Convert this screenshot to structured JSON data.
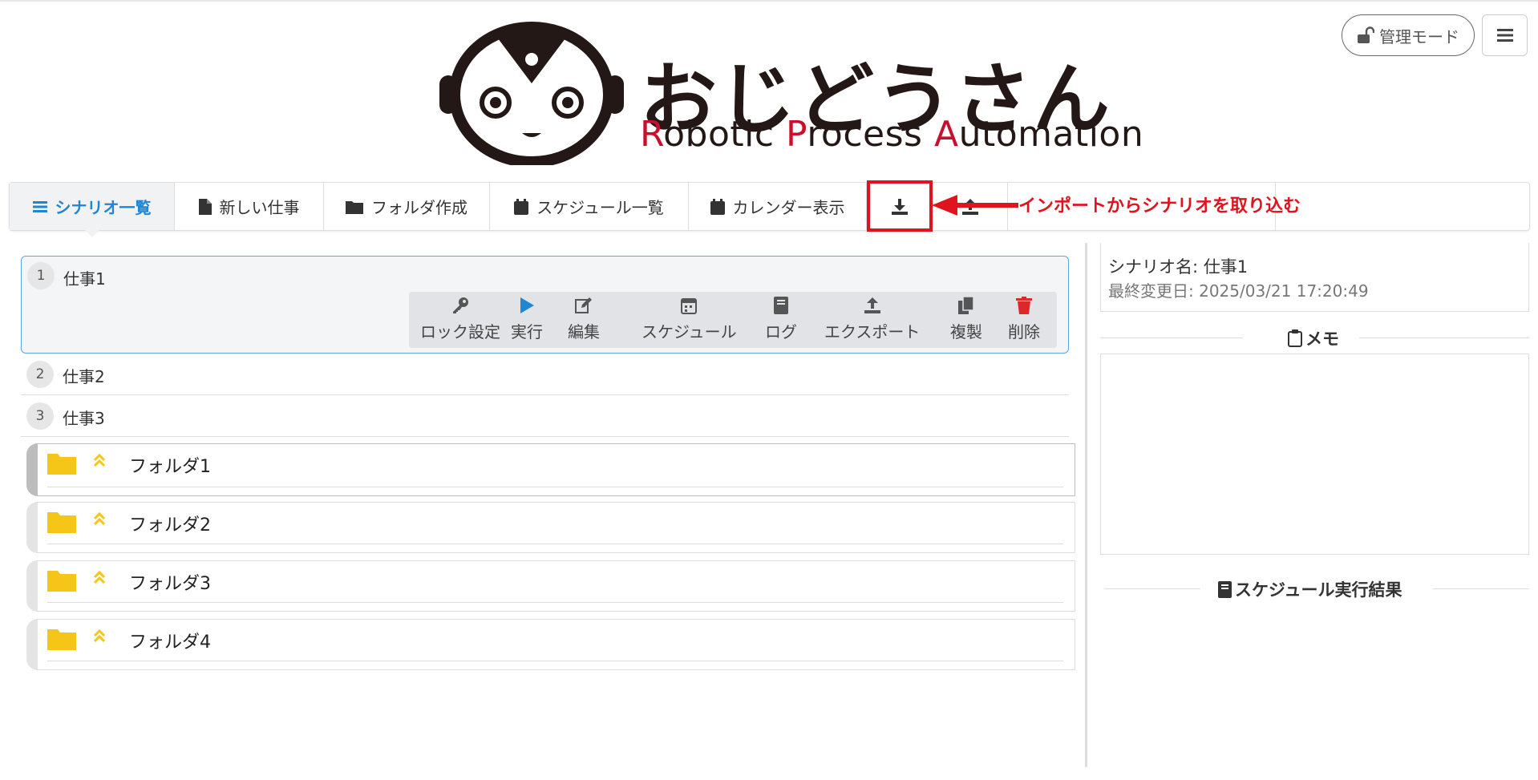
{
  "header": {
    "logo_title": "おじどうさん",
    "logo_sub_r1": "R",
    "logo_sub_1": "obotic ",
    "logo_sub_r2": "P",
    "logo_sub_2": "rocess ",
    "logo_sub_r3": "A",
    "logo_sub_3": "utomation",
    "admin_label": "管理モード"
  },
  "tabs": [
    {
      "label": "シナリオ一覧",
      "icon": "list-icon"
    },
    {
      "label": "新しい仕事",
      "icon": "file-icon"
    },
    {
      "label": "フォルダ作成",
      "icon": "folder-icon"
    },
    {
      "label": "スケジュール一覧",
      "icon": "calendar-icon"
    },
    {
      "label": "カレンダー表示",
      "icon": "calendar-icon"
    },
    {
      "label": "",
      "icon": "import-icon"
    },
    {
      "label": "",
      "icon": "export-icon"
    }
  ],
  "annotation": "インポートからシナリオを取り込む",
  "tasks": [
    {
      "num": "1",
      "name": "仕事1"
    },
    {
      "num": "2",
      "name": "仕事2"
    },
    {
      "num": "3",
      "name": "仕事3"
    }
  ],
  "actions": [
    {
      "label": "ロック設定",
      "icon": "key-icon"
    },
    {
      "label": "実行",
      "icon": "play-icon"
    },
    {
      "label": "編集",
      "icon": "edit-icon"
    },
    {
      "label": "スケジュール",
      "icon": "calendar-icon"
    },
    {
      "label": "ログ",
      "icon": "book-icon"
    },
    {
      "label": "エクスポート",
      "icon": "upload-icon"
    },
    {
      "label": "複製",
      "icon": "copy-icon"
    },
    {
      "label": "削除",
      "icon": "trash-icon"
    }
  ],
  "folders": [
    {
      "name": "フォルダ1"
    },
    {
      "name": "フォルダ2"
    },
    {
      "name": "フォルダ3"
    },
    {
      "name": "フォルダ4"
    }
  ],
  "detail": {
    "scenario_name": "シナリオ名: 仕事1",
    "last_modified": "最終変更日: 2025/03/21 17:20:49",
    "memo_header": "メモ",
    "schedule_header": "スケジュール実行結果"
  },
  "colors": {
    "accent_blue": "#2185d0",
    "annotation_red": "#e0141e",
    "folder_yellow": "#f5c518",
    "delete_red": "#db2828"
  }
}
